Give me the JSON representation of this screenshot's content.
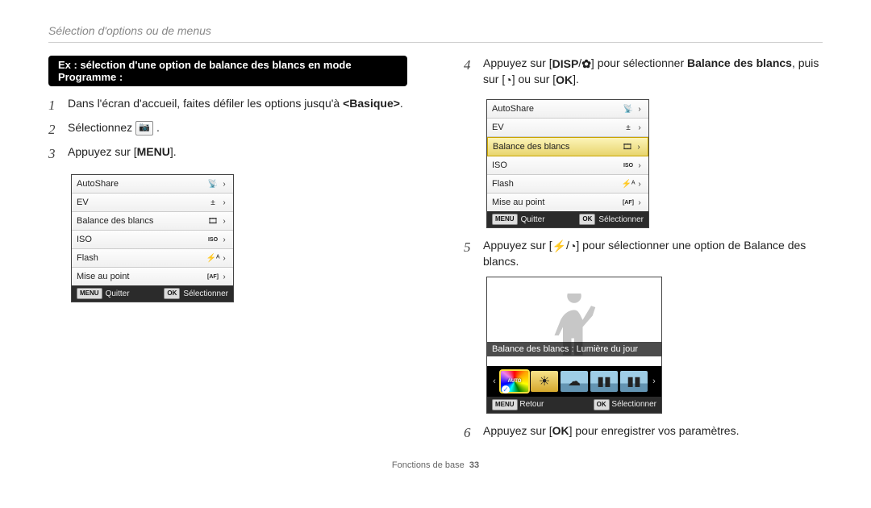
{
  "header": "Sélection d'options ou de menus",
  "example_title": "Ex : sélection d'une option de balance des blancs en mode Programme :",
  "left": {
    "step1": {
      "num": "1",
      "text_a": "Dans l'écran d'accueil, faites défiler les options jusqu'à ",
      "text_b": "<Basique>",
      "text_c": "."
    },
    "step2": {
      "num": "2",
      "text_a": "Sélectionnez ",
      "icon_alt": "mode-photo-icon",
      "text_b": "."
    },
    "step3": {
      "num": "3",
      "text_a": "Appuyez sur [",
      "key": "MENU",
      "text_b": "]."
    },
    "menu": {
      "rows": [
        {
          "label": "AutoShare",
          "icon": "📡"
        },
        {
          "label": "EV",
          "icon": "±"
        },
        {
          "label": "Balance des blancs",
          "icon": "🎞"
        },
        {
          "label": "ISO",
          "icon": "ISO"
        },
        {
          "label": "Flash",
          "icon": "⚡ᴬ"
        },
        {
          "label": "Mise au point",
          "icon": "[AF]"
        }
      ],
      "footer_left": "Quitter",
      "footer_left_key": "MENU",
      "footer_right": "Sélectionner",
      "footer_right_key": "OK"
    }
  },
  "right": {
    "step4": {
      "num": "4",
      "text_a": "Appuyez sur [",
      "k1": "DISP",
      "sep1": "/",
      "k2_icon": "flower",
      "text_b": "] pour sélectionner ",
      "bold": "Balance des blancs",
      "text_c": ", puis sur [",
      "k3_icon": "timer",
      "text_d": "] ou sur [",
      "k4": "OK",
      "text_e": "]."
    },
    "menu": {
      "rows": [
        {
          "label": "AutoShare",
          "icon": "📡"
        },
        {
          "label": "EV",
          "icon": "±"
        },
        {
          "label": "Balance des blancs",
          "icon": "🎞",
          "highlight": true
        },
        {
          "label": "ISO",
          "icon": "ISO"
        },
        {
          "label": "Flash",
          "icon": "⚡ᴬ"
        },
        {
          "label": "Mise au point",
          "icon": "[AF]"
        }
      ],
      "footer_left": "Quitter",
      "footer_left_key": "MENU",
      "footer_right": "Sélectionner",
      "footer_right_key": "OK"
    },
    "step5": {
      "num": "5",
      "text_a": "Appuyez sur [",
      "k1_icon": "flash",
      "sep1": "/",
      "k2_icon": "timer",
      "text_b": "] pour sélectionner une option de Balance des blancs."
    },
    "viewer": {
      "caption": "Balance des blancs : Lumière du jour",
      "auto_badge": "AUTO",
      "footer_left": "Retour",
      "footer_left_key": "MENU",
      "footer_right": "Sélectionner",
      "footer_right_key": "OK"
    },
    "step6": {
      "num": "6",
      "text_a": "Appuyez sur [",
      "k1": "OK",
      "text_b": "] pour enregistrer vos paramètres."
    }
  },
  "footer": {
    "label": "Fonctions de base",
    "page": "33"
  }
}
